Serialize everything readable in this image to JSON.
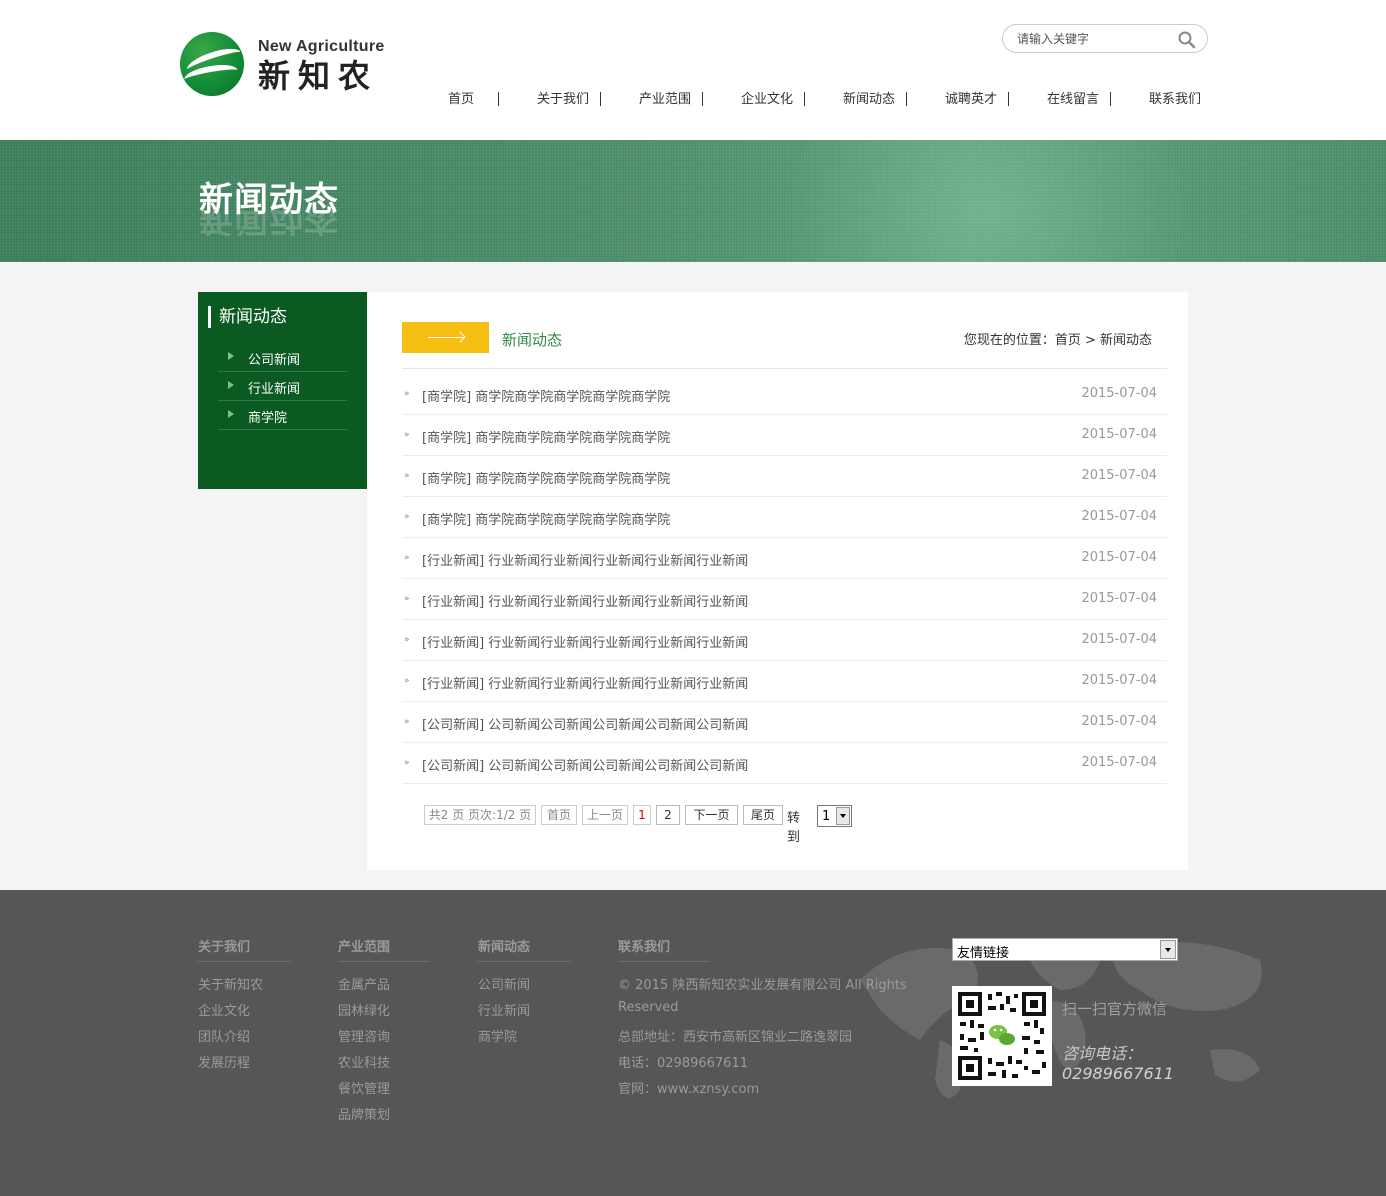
{
  "header": {
    "logo_en": "New Agriculture",
    "logo_cn": "新知农",
    "search_placeholder": "请输入关键字",
    "nav": [
      "首页",
      "关于我们",
      "产业范围",
      "企业文化",
      "新闻动态",
      "诚聘英才",
      "在线留言",
      "联系我们"
    ]
  },
  "banner": {
    "title": "新闻动态"
  },
  "side": {
    "title": "新闻动态",
    "items": [
      "公司新闻",
      "行业新闻",
      "商学院"
    ]
  },
  "content": {
    "title": "新闻动态",
    "breadcrumb": "您现在的位置：首页 > 新闻动态",
    "news": [
      {
        "title": "[商学院] 商学院商学院商学院商学院商学院",
        "date": "2015-07-04"
      },
      {
        "title": "[商学院] 商学院商学院商学院商学院商学院",
        "date": "2015-07-04"
      },
      {
        "title": "[商学院] 商学院商学院商学院商学院商学院",
        "date": "2015-07-04"
      },
      {
        "title": "[商学院] 商学院商学院商学院商学院商学院",
        "date": "2015-07-04"
      },
      {
        "title": "[行业新闻] 行业新闻行业新闻行业新闻行业新闻行业新闻",
        "date": "2015-07-04"
      },
      {
        "title": "[行业新闻] 行业新闻行业新闻行业新闻行业新闻行业新闻",
        "date": "2015-07-04"
      },
      {
        "title": "[行业新闻] 行业新闻行业新闻行业新闻行业新闻行业新闻",
        "date": "2015-07-04"
      },
      {
        "title": "[行业新闻] 行业新闻行业新闻行业新闻行业新闻行业新闻",
        "date": "2015-07-04"
      },
      {
        "title": "[公司新闻] 公司新闻公司新闻公司新闻公司新闻公司新闻",
        "date": "2015-07-04"
      },
      {
        "title": "[公司新闻] 公司新闻公司新闻公司新闻公司新闻公司新闻",
        "date": "2015-07-04"
      }
    ],
    "pager": {
      "summary": "共2 页 页次:1/2 页",
      "first": "首页",
      "prev": "上一页",
      "pages": [
        "1",
        "2"
      ],
      "next": "下一页",
      "last": "尾页",
      "goto": "转到",
      "selected": "1"
    }
  },
  "footer": {
    "cols": [
      {
        "title": "关于我们",
        "links": [
          "关于新知农",
          "企业文化",
          "团队介绍",
          "发展历程"
        ]
      },
      {
        "title": "产业范围",
        "links": [
          "金属产品",
          "园林绿化",
          "管理咨询",
          "农业科技",
          "餐饮管理",
          "品牌策划"
        ]
      },
      {
        "title": "新闻动态",
        "links": [
          "公司新闻",
          "行业新闻",
          "商学院"
        ]
      }
    ],
    "contact": {
      "title": "联系我们",
      "lines": [
        "© 2015 陕西新知农实业发展有限公司 All Rights",
        "Reserved",
        "总部地址：西安市高新区锦业二路逸翠园",
        "电话：02989667611",
        "官网：www.xznsy.com"
      ]
    },
    "friend_links": "友情链接",
    "scan_text": "扫一扫官方微信",
    "phone_label": "咨询电话：",
    "phone": "02989667611"
  }
}
